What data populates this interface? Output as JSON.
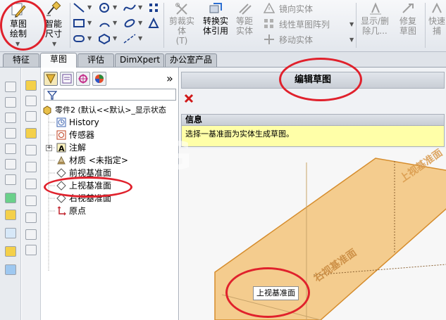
{
  "ribbon": {
    "sketch_btn": "草图绘制",
    "smart_dim_btn": "智能尺寸",
    "trim_btn": "剪裁实体",
    "trim_btn_suffix": "(T)",
    "convert_btn": "转换实体引用",
    "offset_btn": "等距实体",
    "mirror_label": "镜向实体",
    "linear_pattern_label": "线性草图阵列",
    "move_label": "移动实体",
    "show_delete_btn": "显示/删除几...",
    "repair_btn": "修复草图",
    "quick_btn": "快速捕"
  },
  "tabs": [
    "特征",
    "草图",
    "评估",
    "DimXpert",
    "办公室产品"
  ],
  "tree": {
    "part": "零件2 (默认<<默认>_显示状态",
    "nodes": [
      "History",
      "传感器",
      "注解",
      "材质 <未指定>",
      "前视基准面",
      "上视基准面",
      "右视基准面",
      "原点"
    ],
    "more": "»"
  },
  "edit": {
    "title": "编辑草图",
    "info_header": "信息",
    "info_text": "选择一基准面为实体生成草图。"
  },
  "canvas": {
    "plane_top": "上视基准面",
    "plane_right": "右视基准面",
    "tooltip": "上视基准面",
    "watermark": "G"
  },
  "colors": {
    "highlight": "#e0212c",
    "plane_fill": "#f3bd6b",
    "plane_edge": "#d58c2c",
    "info_bg": "#ffffa8"
  }
}
